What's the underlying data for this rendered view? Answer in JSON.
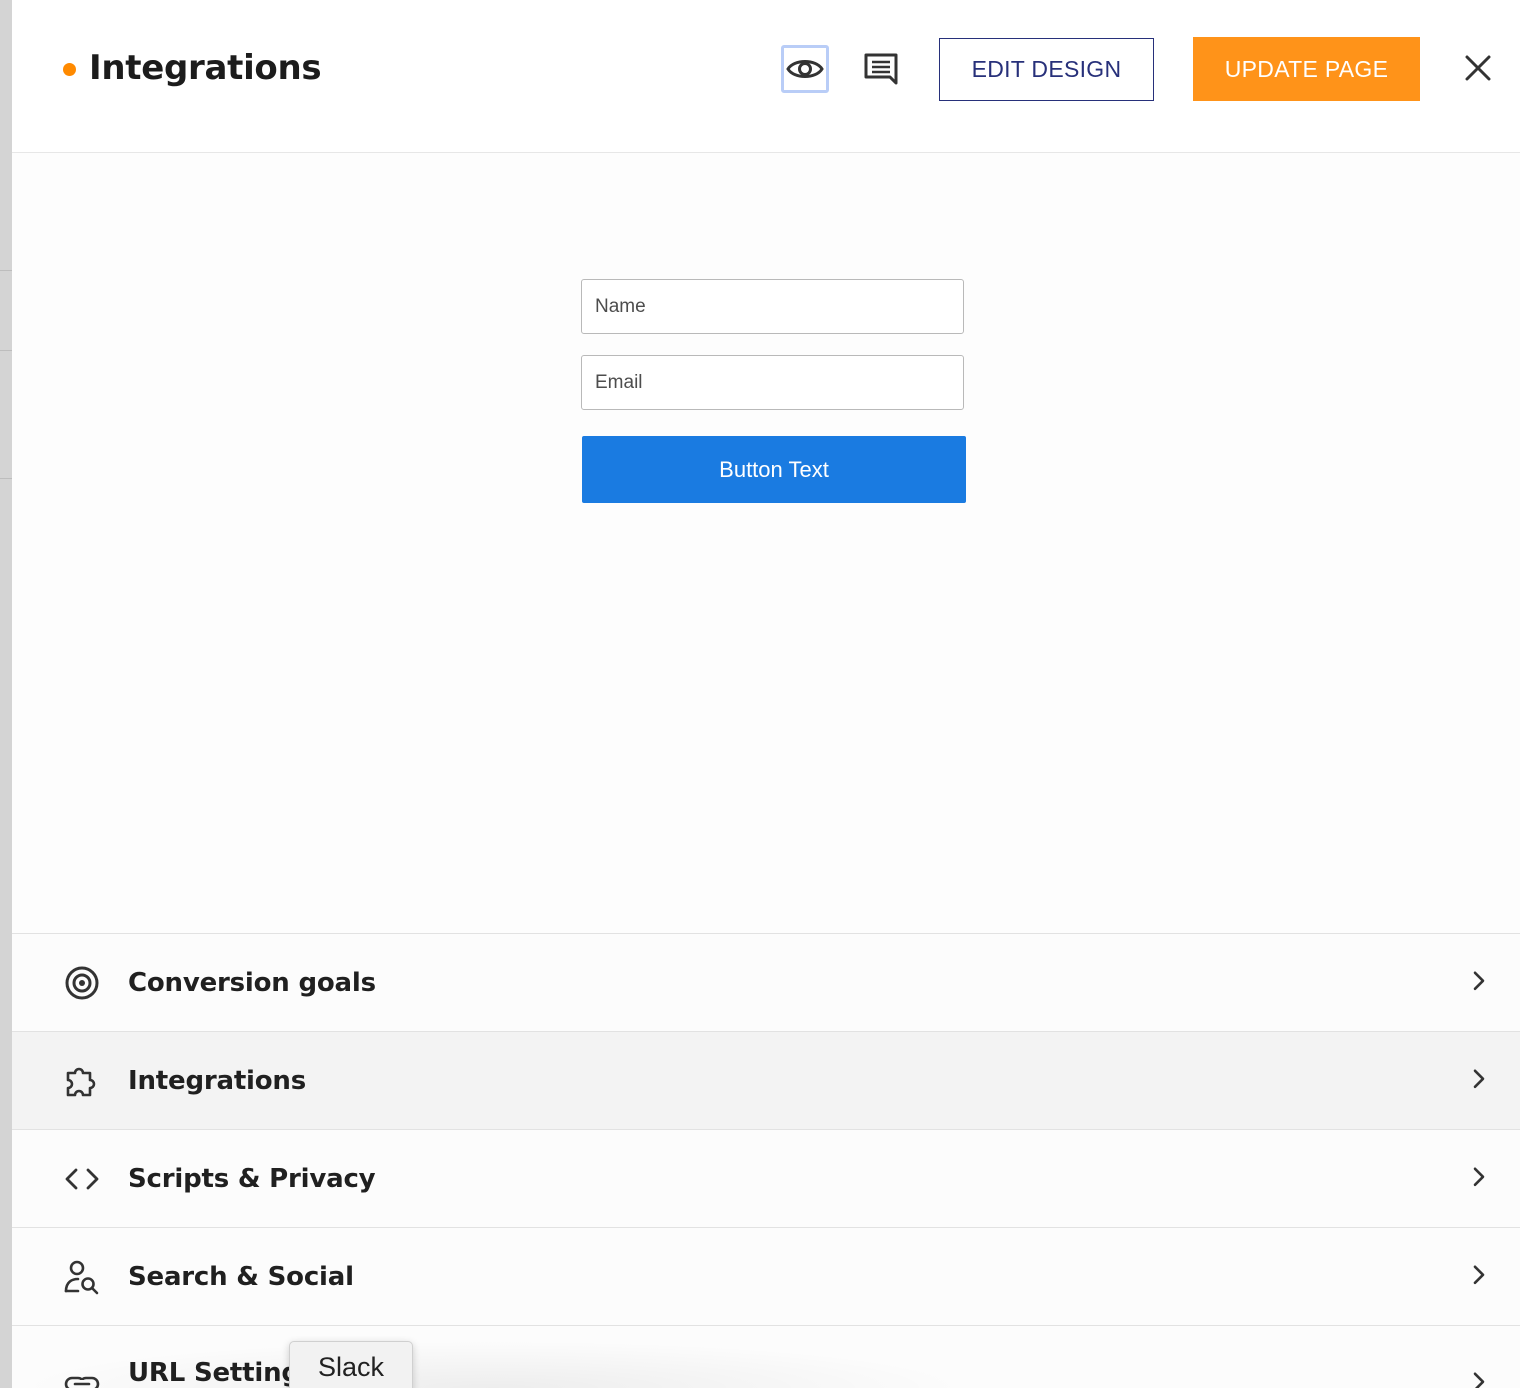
{
  "header": {
    "title": "Integrations",
    "status_color": "#ff8a00",
    "icons": {
      "preview": "eye-icon",
      "comments": "comment-icon",
      "close": "close-icon"
    },
    "edit_design_label": "EDIT DESIGN",
    "update_page_label": "UPDATE PAGE"
  },
  "form": {
    "name_placeholder": "Name",
    "email_placeholder": "Email",
    "button_label": "Button Text",
    "button_color": "#1a7be1"
  },
  "menu": {
    "items": [
      {
        "label": "Conversion goals",
        "icon": "target-icon",
        "active": false
      },
      {
        "label": "Integrations",
        "icon": "puzzle-icon",
        "active": true
      },
      {
        "label": "Scripts & Privacy",
        "icon": "code-icon",
        "active": false
      },
      {
        "label": "Search & Social",
        "icon": "user-search-icon",
        "active": false
      },
      {
        "label": "URL Settings",
        "icon": "link-icon",
        "active": false
      }
    ]
  },
  "tooltip": {
    "text": "Slack"
  },
  "colors": {
    "accent_orange": "#ff9319",
    "edit_border": "#27307a"
  }
}
